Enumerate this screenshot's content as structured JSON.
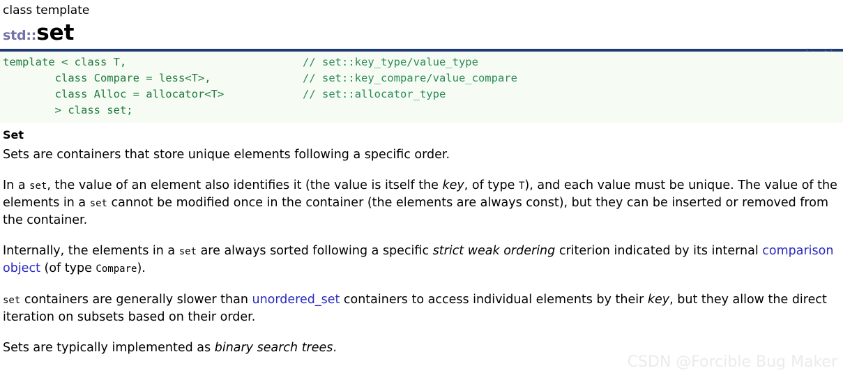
{
  "header": {
    "kicker": "class template",
    "namespace": "std::",
    "name": "set",
    "include": "〈set〉"
  },
  "code": {
    "lines": [
      {
        "code": "template < class T,",
        "comment": "// set::key_type/value_type"
      },
      {
        "code": "        class Compare = less<T>,",
        "comment": "// set::key_compare/value_compare"
      },
      {
        "code": "        class Alloc = allocator<T>",
        "comment": "// set::allocator_type"
      },
      {
        "code": "        > class set;",
        "comment": ""
      }
    ]
  },
  "section": {
    "heading": "Set",
    "paragraphs": {
      "p1": "Sets are containers that store unique elements following a specific order.",
      "p2": {
        "s1": "In a ",
        "c1": "set",
        "s2": ", the value of an element also identifies it (the value is itself the ",
        "i1": "key",
        "s3": ", of type ",
        "c2": "T",
        "s4": "), and each value must be unique. The value of the elements in a ",
        "c3": "set",
        "s5": " cannot be modified once in the container (the elements are always const), but they can be inserted or removed from the container."
      },
      "p3": {
        "s1": "Internally, the elements in a ",
        "c1": "set",
        "s2": " are always sorted following a specific ",
        "i1": "strict weak ordering",
        "s3": " criterion indicated by its internal ",
        "link1": "comparison object",
        "s4": " (of type ",
        "c2": "Compare",
        "s5": ")."
      },
      "p4": {
        "c1": "set",
        "s1": " containers are generally slower than ",
        "link1": "unordered_set",
        "s2": " containers to access individual elements by their ",
        "i1": "key",
        "s3": ", but they allow the direct iteration on subsets based on their order."
      },
      "p5": {
        "s1": "Sets are typically implemented as ",
        "i1": "binary search trees",
        "s2": "."
      }
    }
  },
  "watermark": "CSDN @Forcible Bug Maker",
  "colors": {
    "rule": "#1f3a73",
    "code_bg": "#f6fcf4",
    "code_text": "#1f7a3d",
    "namespace": "#7272a8",
    "link": "#2a2ac0",
    "include": "#46607e",
    "watermark": "#ebebeb"
  }
}
